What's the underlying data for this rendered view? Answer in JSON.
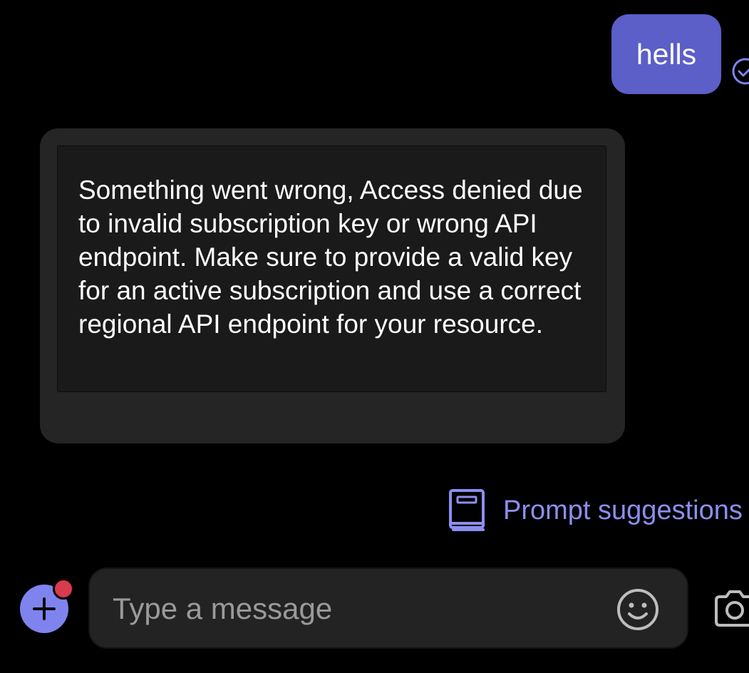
{
  "chat": {
    "outgoing": [
      {
        "text": "hells",
        "status": "sent"
      }
    ],
    "incoming": [
      {
        "text": "Something went wrong, Access denied due to invalid subscription key or wrong API endpoint. Make sure to provide a valid key for an active subscription and use a correct regional API endpoint for your resource."
      }
    ]
  },
  "prompt_suggestions": {
    "label": "Prompt suggestions",
    "icon": "book-icon"
  },
  "composer": {
    "placeholder": "Type a message",
    "value": "",
    "add_icon": "plus-icon",
    "emoji_icon": "emoji-icon",
    "camera_icon": "camera-icon"
  },
  "colors": {
    "background": "#000000",
    "outgoing_bubble": "#5b5fc7",
    "incoming_card": "#252525",
    "accent": "#8b8ff0",
    "badge": "#d93a4d"
  }
}
